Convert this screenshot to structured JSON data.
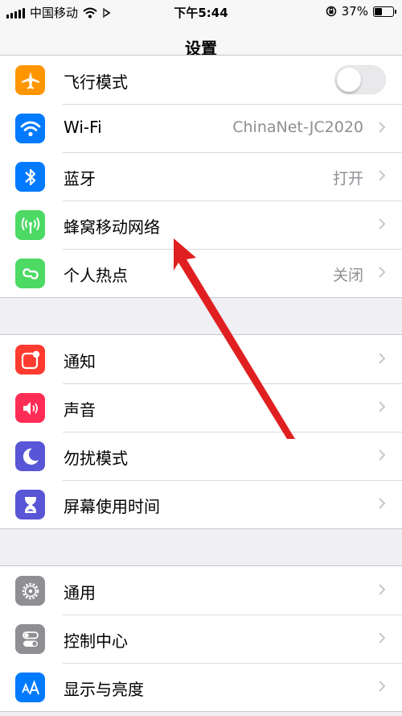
{
  "status_bar": {
    "carrier": "中国移动",
    "time": "下午5:44",
    "battery_percent": "37%",
    "battery_level": 0.37
  },
  "nav": {
    "title": "设置"
  },
  "groups": [
    {
      "items": [
        {
          "label": "飞行模式",
          "icon": "airplane-icon",
          "color": "#ff9500",
          "control": "toggle",
          "toggle_on": false
        },
        {
          "label": "Wi-Fi",
          "icon": "wifi-icon",
          "color": "#007aff",
          "detail": "ChinaNet-JC2020"
        },
        {
          "label": "蓝牙",
          "icon": "bluetooth-icon",
          "color": "#007aff",
          "detail": "打开"
        },
        {
          "label": "蜂窝移动网络",
          "icon": "cellular-antenna-icon",
          "color": "#4cd964",
          "detail": ""
        },
        {
          "label": "个人热点",
          "icon": "hotspot-link-icon",
          "color": "#4cd964",
          "detail": "关闭"
        }
      ]
    },
    {
      "items": [
        {
          "label": "通知",
          "icon": "notifications-icon",
          "color": "#ff3b30"
        },
        {
          "label": "声音",
          "icon": "speaker-icon",
          "color": "#ff2d55"
        },
        {
          "label": "勿扰模式",
          "icon": "moon-icon",
          "color": "#5856d6"
        },
        {
          "label": "屏幕使用时间",
          "icon": "hourglass-icon",
          "color": "#5856d6"
        }
      ]
    },
    {
      "items": [
        {
          "label": "通用",
          "icon": "gear-icon",
          "color": "#8e8e93"
        },
        {
          "label": "控制中心",
          "icon": "toggles-icon",
          "color": "#8e8e93"
        },
        {
          "label": "显示与亮度",
          "icon": "text-size-icon",
          "color": "#007aff"
        }
      ]
    }
  ],
  "annotation": {
    "icon": "red-arrow-annotation",
    "color": "#e02020"
  }
}
